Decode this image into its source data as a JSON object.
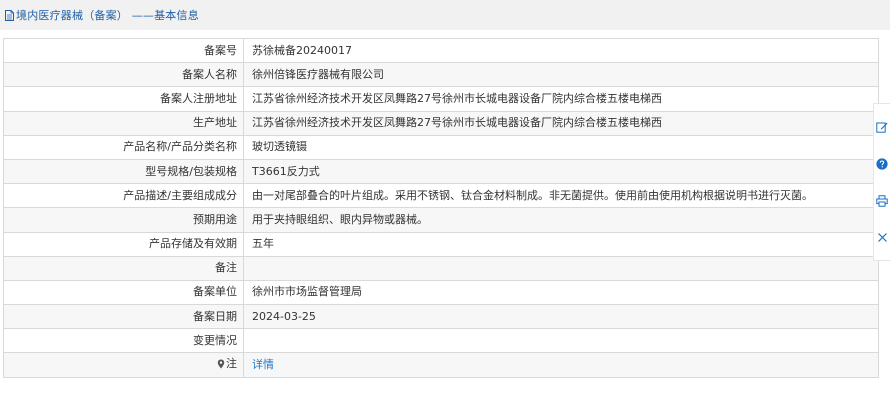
{
  "header": {
    "title": "境内医疗器械（备案） ——基本信息"
  },
  "rows": [
    {
      "label": "备案号",
      "value": "苏徐械备20240017"
    },
    {
      "label": "备案人名称",
      "value": "徐州倍锋医疗器械有限公司"
    },
    {
      "label": "备案人注册地址",
      "value": "江苏省徐州经济技术开发区凤舞路27号徐州市长城电器设备厂院内综合楼五楼电梯西"
    },
    {
      "label": "生产地址",
      "value": "江苏省徐州经济技术开发区凤舞路27号徐州市长城电器设备厂院内综合楼五楼电梯西"
    },
    {
      "label": "产品名称/产品分类名称",
      "value": "玻切透镜镊"
    },
    {
      "label": "型号规格/包装规格",
      "value": "T3661反力式"
    },
    {
      "label": "产品描述/主要组成成分",
      "value": "由一对尾部叠合的叶片组成。采用不锈钢、钛合金材料制成。非无菌提供。使用前由使用机构根据说明书进行灭菌。"
    },
    {
      "label": "预期用途",
      "value": "用于夹持眼组织、眼内异物或器械。"
    },
    {
      "label": "产品存储及有效期",
      "value": "五年"
    },
    {
      "label": "备注",
      "value": ""
    },
    {
      "label": "备案单位",
      "value": "徐州市市场监督管理局"
    },
    {
      "label": "备案日期",
      "value": "2024-03-25"
    },
    {
      "label": "变更情况",
      "value": ""
    }
  ],
  "note_row": {
    "label": "注",
    "link_text": "详情"
  },
  "icons": {
    "header_icon": "document-icon",
    "note_icon": "map-pin-icon",
    "toolbar": [
      "edit-icon",
      "help-icon",
      "print-icon",
      "close-icon"
    ]
  },
  "colors": {
    "header_bg": "#f1f1f1",
    "title_text": "#1f5fa5",
    "link": "#1f77c9",
    "border": "#d9d9d9",
    "stripe": "#f7f7f7",
    "toolbar_blue": "#1a6fc4"
  }
}
